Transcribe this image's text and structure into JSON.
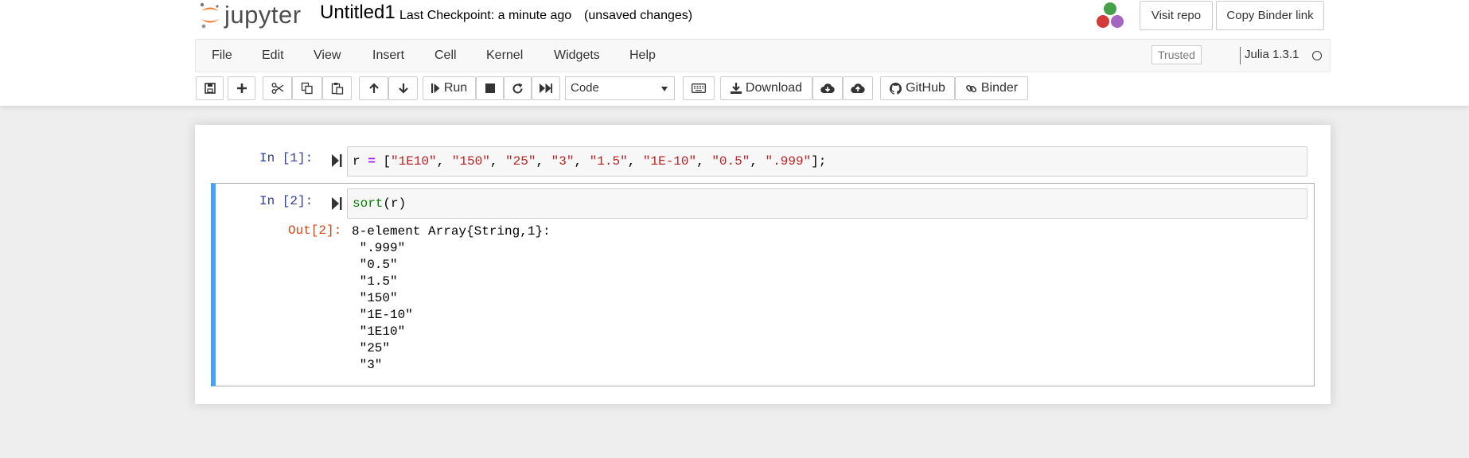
{
  "header": {
    "logo_text": "jupyter",
    "notebook_name": "Untitled1",
    "checkpoint": "Last Checkpoint: a minute ago",
    "status": "(unsaved changes)",
    "visit_repo": "Visit repo",
    "copy_binder_link": "Copy Binder link"
  },
  "menubar": {
    "items": [
      "File",
      "Edit",
      "View",
      "Insert",
      "Cell",
      "Kernel",
      "Widgets",
      "Help"
    ],
    "trusted": "Trusted",
    "kernel_name": "Julia 1.3.1"
  },
  "toolbar": {
    "run_label": "Run",
    "cell_type": "Code",
    "download_label": "Download",
    "github_label": "GitHub",
    "binder_label": "Binder"
  },
  "cells": [
    {
      "prompt": "In [1]:",
      "tokens": [
        {
          "t": "r",
          "c": "v"
        },
        {
          "t": " ",
          "c": "p"
        },
        {
          "t": "=",
          "c": "op"
        },
        {
          "t": " [",
          "c": "p"
        },
        {
          "t": "\"1E10\"",
          "c": "s"
        },
        {
          "t": ", ",
          "c": "p"
        },
        {
          "t": "\"150\"",
          "c": "s"
        },
        {
          "t": ", ",
          "c": "p"
        },
        {
          "t": "\"25\"",
          "c": "s"
        },
        {
          "t": ", ",
          "c": "p"
        },
        {
          "t": "\"3\"",
          "c": "s"
        },
        {
          "t": ", ",
          "c": "p"
        },
        {
          "t": "\"1.5\"",
          "c": "s"
        },
        {
          "t": ", ",
          "c": "p"
        },
        {
          "t": "\"1E-10\"",
          "c": "s"
        },
        {
          "t": ", ",
          "c": "p"
        },
        {
          "t": "\"0.5\"",
          "c": "s"
        },
        {
          "t": ", ",
          "c": "p"
        },
        {
          "t": "\".999\"",
          "c": "s"
        },
        {
          "t": "];",
          "c": "p"
        }
      ]
    },
    {
      "prompt": "In [2]:",
      "tokens": [
        {
          "t": "sort",
          "c": "f"
        },
        {
          "t": "(",
          "c": "p"
        },
        {
          "t": "r",
          "c": "v"
        },
        {
          "t": ")",
          "c": "p"
        }
      ],
      "out_prompt": "Out[2]:",
      "output": "8-element Array{String,1}:\n \".999\"\n \"0.5\"\n \"1.5\"\n \"150\"\n \"1E-10\"\n \"1E10\"\n \"25\"\n \"3\""
    }
  ],
  "colors": {
    "selected_cell_bar": "#42a5f5",
    "in_prompt": "#303f9f",
    "out_prompt": "#d84315",
    "string": "#ba2121",
    "operator": "#aa22ff",
    "builtin": "#008000"
  }
}
